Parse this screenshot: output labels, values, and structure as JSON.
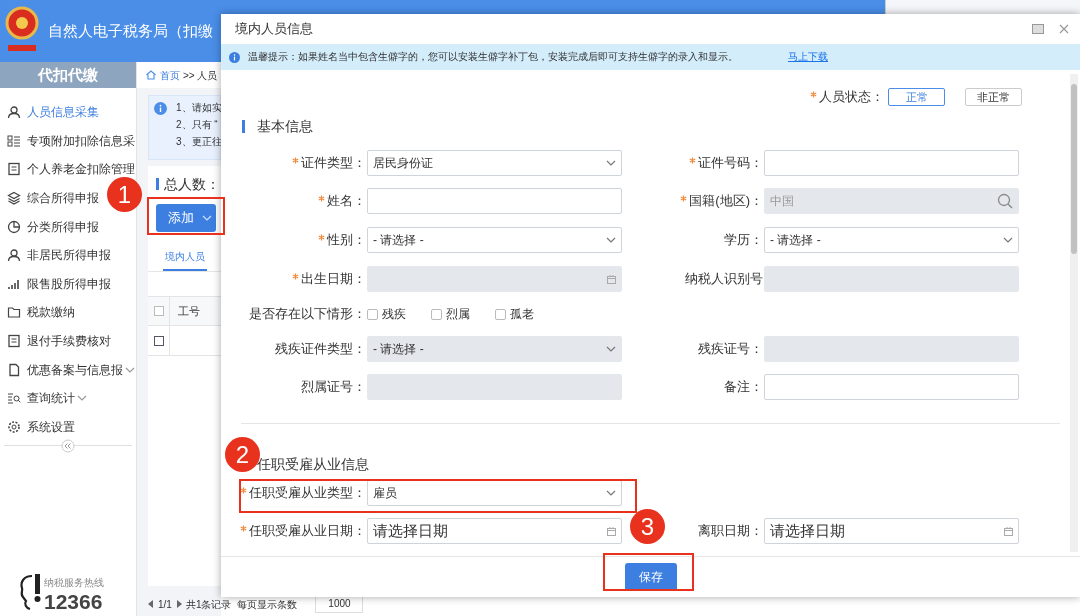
{
  "app": {
    "title": "自然人电子税务局（扣缴",
    "sidebar": {
      "header": "代扣代缴",
      "items": [
        {
          "label": "人员信息采集",
          "selected": true,
          "expandable": false
        },
        {
          "label": "专项附加扣除信息采",
          "selected": false,
          "expandable": false
        },
        {
          "label": "个人养老金扣除管理",
          "selected": false,
          "expandable": false
        },
        {
          "label": "综合所得申报",
          "selected": false,
          "expandable": false
        },
        {
          "label": "分类所得申报",
          "selected": false,
          "expandable": false
        },
        {
          "label": "非居民所得申报",
          "selected": false,
          "expandable": false
        },
        {
          "label": "限售股所得申报",
          "selected": false,
          "expandable": false
        },
        {
          "label": "税款缴纳",
          "selected": false,
          "expandable": false
        },
        {
          "label": "退付手续费核对",
          "selected": false,
          "expandable": false
        },
        {
          "label": "优惠备案与信息报",
          "selected": false,
          "expandable": true
        },
        {
          "label": "查询统计",
          "selected": false,
          "expandable": true
        },
        {
          "label": "系统设置",
          "selected": false,
          "expandable": false
        }
      ],
      "hotline_label": "纳税服务热线",
      "hotline_number": "12366"
    },
    "breadcrumb": {
      "home": "首页",
      "current": ">> 人员"
    },
    "notice_lines": [
      "1、请如实",
      "2、只有 “",
      "3、更正往"
    ],
    "total_label": "总人数：",
    "add_button": "添加",
    "tab": {
      "label": "境内人员",
      "selected": true
    },
    "table": {
      "columns": [
        "工号"
      ],
      "all_checked": false,
      "rows": [
        {
          "checked": false
        }
      ]
    },
    "pager": {
      "page": "1/1",
      "records": "共1条记录",
      "per_page_label": "每页显示条数",
      "per_page": "1000"
    }
  },
  "dialog": {
    "title": "境内人员信息",
    "notice": "温馨提示：如果姓名当中包含生僻字的，您可以安装生僻字补丁包，安装完成后即可支持生僻字的录入和显示。",
    "notice_link": "马上下载",
    "status": {
      "label": "人员状态：",
      "required": true,
      "options": [
        {
          "label": "正常",
          "selected": true
        },
        {
          "label": "非正常",
          "selected": false
        }
      ]
    },
    "sections": [
      {
        "title": "基本信息",
        "rows": [
          {
            "kind": "pair",
            "fields": [
              {
                "label": "证件类型：",
                "required": true,
                "kind": "select",
                "value": "居民身份证",
                "disabled": false
              },
              {
                "label": "证件号码：",
                "required": true,
                "kind": "text",
                "disabled": false
              }
            ]
          },
          {
            "kind": "pair",
            "fields": [
              {
                "label": "姓名：",
                "required": true,
                "kind": "text",
                "disabled": false
              },
              {
                "label": "国籍(地区)：",
                "required": true,
                "kind": "lookup",
                "value": "中国",
                "disabled": true
              }
            ]
          },
          {
            "kind": "pair",
            "fields": [
              {
                "label": "性别：",
                "required": true,
                "kind": "select",
                "value": "- 请选择 -",
                "disabled": false
              },
              {
                "label": "学历：",
                "required": false,
                "kind": "select",
                "value": "- 请选择 -",
                "disabled": false
              }
            ]
          },
          {
            "kind": "pair",
            "fields": [
              {
                "label": "出生日期：",
                "required": true,
                "kind": "date",
                "disabled": true
              },
              {
                "label": "纳税人识别号",
                "required": false,
                "kind": "text",
                "disabled": true
              }
            ]
          },
          {
            "kind": "checks",
            "label": "是否存在以下情形：",
            "options": [
              {
                "label": "残疾",
                "checked": false
              },
              {
                "label": "烈属",
                "checked": false
              },
              {
                "label": "孤老",
                "checked": false
              }
            ]
          },
          {
            "kind": "pair",
            "fields": [
              {
                "label": "残疾证件类型：",
                "required": false,
                "kind": "select",
                "value": "- 请选择 -",
                "disabled": true
              },
              {
                "label": "残疾证号：",
                "required": false,
                "kind": "text",
                "disabled": true
              }
            ]
          },
          {
            "kind": "pair",
            "fields": [
              {
                "label": "烈属证号：",
                "required": false,
                "kind": "text",
                "disabled": true
              },
              {
                "label": "备注：",
                "required": false,
                "kind": "text",
                "disabled": false
              }
            ]
          }
        ]
      },
      {
        "title": "任职受雇从业信息",
        "rows": [
          {
            "kind": "pair",
            "fields": [
              {
                "label": "任职受雇从业类型：",
                "required": true,
                "kind": "select",
                "value": "雇员",
                "disabled": false
              }
            ]
          },
          {
            "kind": "pair",
            "fields": [
              {
                "label": "任职受雇从业日期：",
                "required": true,
                "kind": "date",
                "placeholder": "请选择日期",
                "disabled": false
              },
              {
                "label": "离职日期：",
                "required": false,
                "kind": "date",
                "placeholder": "请选择日期",
                "disabled": false
              }
            ]
          }
        ]
      }
    ],
    "save_button": "保存"
  },
  "annotations": [
    {
      "number": "1"
    },
    {
      "number": "2"
    },
    {
      "number": "3"
    }
  ]
}
